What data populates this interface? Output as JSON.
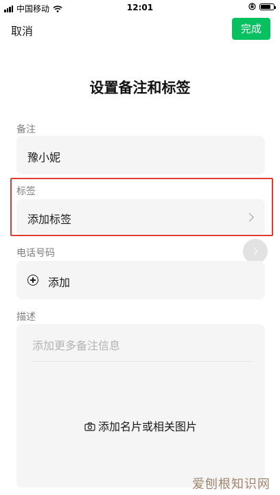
{
  "status_bar": {
    "carrier": "中国移动",
    "time": "12:01",
    "battery_level": 0.82
  },
  "nav": {
    "cancel_label": "取消",
    "done_label": "完成",
    "accent_color": "#07c160"
  },
  "title": "设置备注和标签",
  "remark": {
    "label": "备注",
    "value": "豫小妮"
  },
  "tags": {
    "label": "标签",
    "value": "添加标签",
    "highlight_color": "#e23b2d"
  },
  "phone": {
    "label": "电话号码",
    "add_label": "添加"
  },
  "description": {
    "label": "描述",
    "placeholder": "添加更多备注信息",
    "add_image_label": "添加名片或相关图片"
  },
  "watermark": "爱刨根知识网",
  "icons": [
    "signal-icon",
    "wifi-icon",
    "lock-rotation-icon",
    "battery-icon",
    "chevron-right-icon",
    "add-circle-icon",
    "camera-icon"
  ]
}
